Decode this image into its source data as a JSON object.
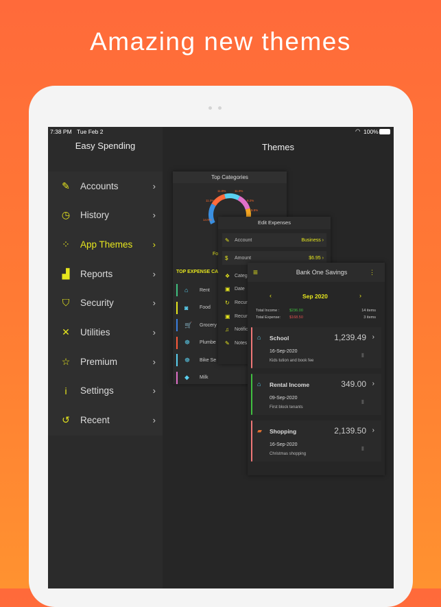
{
  "headline": "Amazing new themes",
  "status": {
    "time": "7:38 PM",
    "date": "Tue Feb 2",
    "battery": "100%"
  },
  "sidebar": {
    "title": "Easy Spending",
    "items": [
      {
        "label": "Accounts",
        "icon": "phone-edit-icon",
        "active": false
      },
      {
        "label": "History",
        "icon": "clock-icon",
        "active": false
      },
      {
        "label": "App Themes",
        "icon": "palette-dots-icon",
        "active": true
      },
      {
        "label": "Reports",
        "icon": "bar-chart-icon",
        "active": false
      },
      {
        "label": "Security",
        "icon": "shield-icon",
        "active": false
      },
      {
        "label": "Utilities",
        "icon": "tools-icon",
        "active": false
      },
      {
        "label": "Premium",
        "icon": "star-icon",
        "active": false
      },
      {
        "label": "Settings",
        "icon": "info-icon",
        "active": false
      },
      {
        "label": "Recent",
        "icon": "refresh-icon",
        "active": false
      }
    ]
  },
  "main": {
    "title": "Themes"
  },
  "top_categories": {
    "title": "Top Categories",
    "percents": [
      "14.9%",
      "11.0%",
      "11.0%",
      "11.0%",
      "8.2%",
      "5.5%"
    ],
    "colors": [
      "#3a8fe0",
      "#ff6a3a",
      "#5ad0f0",
      "#e070c8",
      "#f5a623",
      "#c070f0"
    ],
    "label_fragment": "Fo",
    "section_title": "TOP EXPENSE CA",
    "rows": [
      {
        "label": "Rent",
        "color": "#40c080",
        "icon": "house-icon"
      },
      {
        "label": "Food",
        "color": "#e6e61e",
        "icon": "food-icon"
      },
      {
        "label": "Grocery",
        "color": "#3a7fe0",
        "icon": "cart-icon"
      },
      {
        "label": "Plumbe",
        "color": "#ff5a3a",
        "icon": "worker-icon"
      },
      {
        "label": "Bike Se",
        "color": "#5ad0f0",
        "icon": "worker-icon"
      },
      {
        "label": "Milk",
        "color": "#e070c8",
        "icon": "tag-icon"
      }
    ]
  },
  "edit_expenses": {
    "title": "Edit Expenses",
    "rows": [
      {
        "label": "Account",
        "value": "Business",
        "icon": "edit-icon"
      },
      {
        "label": "Amount",
        "value": "$6.95",
        "icon": "dollar-icon"
      },
      {
        "label": "Catego",
        "value": "",
        "icon": "category-icon"
      },
      {
        "label": "Date",
        "value": "",
        "icon": "calendar-icon"
      },
      {
        "label": "Recurri",
        "value": "",
        "icon": "repeat-icon"
      },
      {
        "label": "Recurri",
        "value": "",
        "icon": "calendar-question-icon"
      },
      {
        "label": "Notific",
        "value": "",
        "icon": "bell-icon"
      },
      {
        "label": "Notes",
        "value": "",
        "icon": "note-icon"
      }
    ]
  },
  "bank": {
    "title": "Bank One Savings",
    "month": "Sep 2020",
    "total_income_label": "Total Income  :",
    "total_income": "$236.00",
    "total_expense_label": "Total Expense:",
    "total_expense": "$168.50",
    "income_items": "14 items",
    "expense_items": "3 items",
    "transactions": [
      {
        "title": "School",
        "amount": "1,239.49",
        "date": "16-Sep-2020",
        "note": "Kids tution and book fee",
        "color": "#f07878",
        "icon": "house-icon"
      },
      {
        "title": "Rental Income",
        "amount": "349.00",
        "date": "09-Sep-2020",
        "note": "First block tenants",
        "color": "#40c040",
        "icon": "house-icon"
      },
      {
        "title": "Shopping",
        "amount": "2,139.50",
        "date": "16-Sep-2020",
        "note": "Christmas shopping",
        "color": "#f07878",
        "icon": "bag-icon"
      }
    ]
  }
}
